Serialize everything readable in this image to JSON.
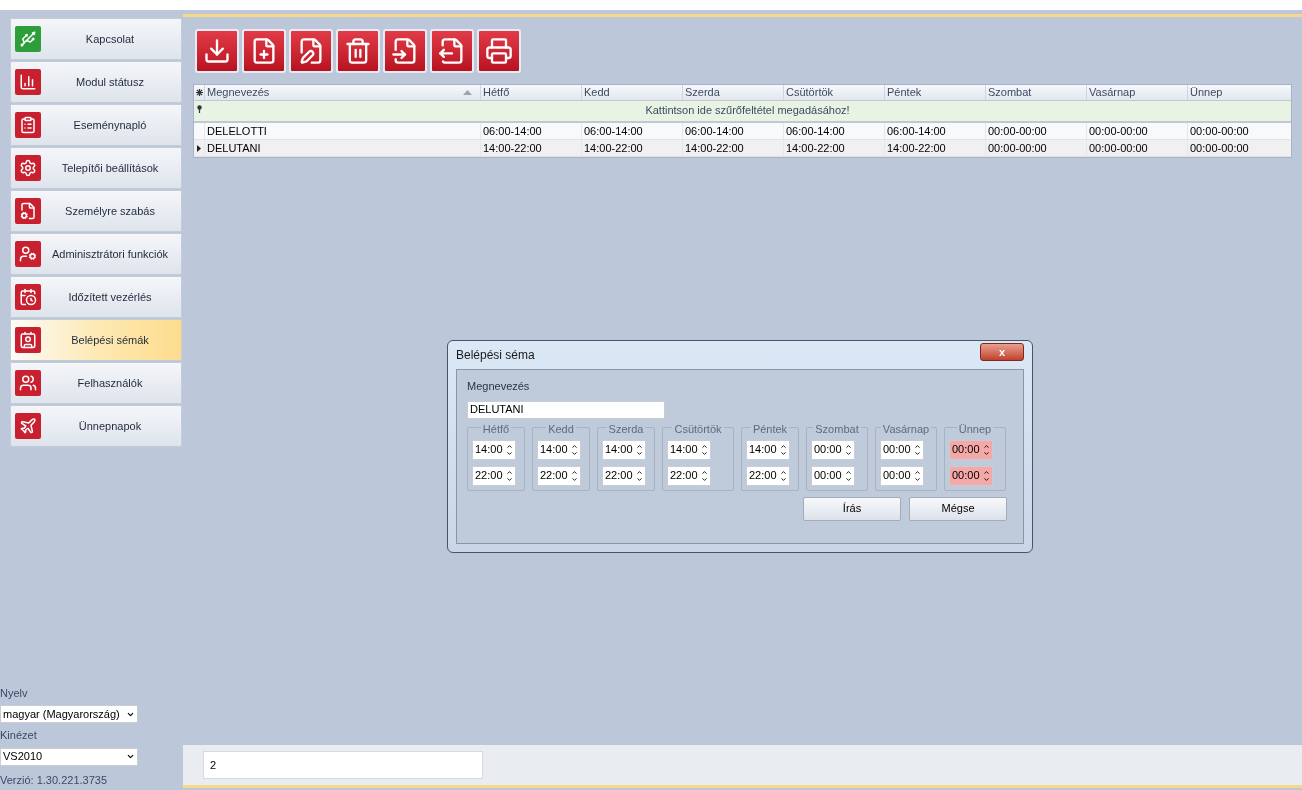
{
  "sidebar": {
    "items": [
      {
        "label": "Kapcsolat",
        "selected": false,
        "color": "#2e9e3a"
      },
      {
        "label": "Modul státusz",
        "selected": false,
        "color": "#c8202f"
      },
      {
        "label": "Eseménynapló",
        "selected": false,
        "color": "#c8202f"
      },
      {
        "label": "Telepítői beállítások",
        "selected": false,
        "color": "#c8202f"
      },
      {
        "label": "Személyre szabás",
        "selected": false,
        "color": "#c8202f"
      },
      {
        "label": "Adminisztrátori funkciók",
        "selected": false,
        "color": "#c8202f"
      },
      {
        "label": "Időzített vezérlés",
        "selected": false,
        "color": "#c8202f"
      },
      {
        "label": "Belépési sémák",
        "selected": true,
        "color": "#c8202f"
      },
      {
        "label": "Felhasználók",
        "selected": false,
        "color": "#c8202f"
      },
      {
        "label": "Ünnepnapok",
        "selected": false,
        "color": "#c8202f"
      }
    ],
    "language_label": "Nyelv",
    "language_value": "magyar (Magyarország)",
    "skin_label": "Kinézet",
    "skin_value": "VS2010",
    "version": "Verzió: 1.30.221.3735"
  },
  "table": {
    "columns": [
      {
        "label": "Megnevezés",
        "sorted": true
      },
      {
        "label": "Hétfő"
      },
      {
        "label": "Kedd"
      },
      {
        "label": "Szerda"
      },
      {
        "label": "Csütörtök"
      },
      {
        "label": "Péntek"
      },
      {
        "label": "Szombat"
      },
      {
        "label": "Vasárnap"
      },
      {
        "label": "Ünnep"
      }
    ],
    "filter_hint": "Kattintson ide szűrőfeltétel megadásához!",
    "rows": [
      {
        "current": false,
        "cells": [
          "DELELOTTI",
          "06:00-14:00",
          "06:00-14:00",
          "06:00-14:00",
          "06:00-14:00",
          "06:00-14:00",
          "00:00-00:00",
          "00:00-00:00",
          "00:00-00:00"
        ]
      },
      {
        "current": true,
        "cells": [
          "DELUTANI",
          "14:00-22:00",
          "14:00-22:00",
          "14:00-22:00",
          "14:00-22:00",
          "14:00-22:00",
          "00:00-00:00",
          "00:00-00:00",
          "00:00-00:00"
        ]
      }
    ]
  },
  "status_field": "2",
  "dialog": {
    "title": "Belépési séma",
    "close": "x",
    "name_label": "Megnevezés",
    "name_value": "DELUTANI",
    "days": [
      {
        "label": "Hétfő",
        "start": "14:00",
        "end": "22:00",
        "invalid": false
      },
      {
        "label": "Kedd",
        "start": "14:00",
        "end": "22:00",
        "invalid": false
      },
      {
        "label": "Szerda",
        "start": "14:00",
        "end": "22:00",
        "invalid": false
      },
      {
        "label": "Csütörtök",
        "start": "14:00",
        "end": "22:00",
        "invalid": false
      },
      {
        "label": "Péntek",
        "start": "14:00",
        "end": "22:00",
        "invalid": false
      },
      {
        "label": "Szombat",
        "start": "00:00",
        "end": "00:00",
        "invalid": false
      },
      {
        "label": "Vasárnap",
        "start": "00:00",
        "end": "00:00",
        "invalid": false
      },
      {
        "label": "Ünnep",
        "start": "00:00",
        "end": "00:00",
        "invalid": true
      }
    ],
    "buttons": [
      "Írás",
      "Mégse"
    ]
  }
}
